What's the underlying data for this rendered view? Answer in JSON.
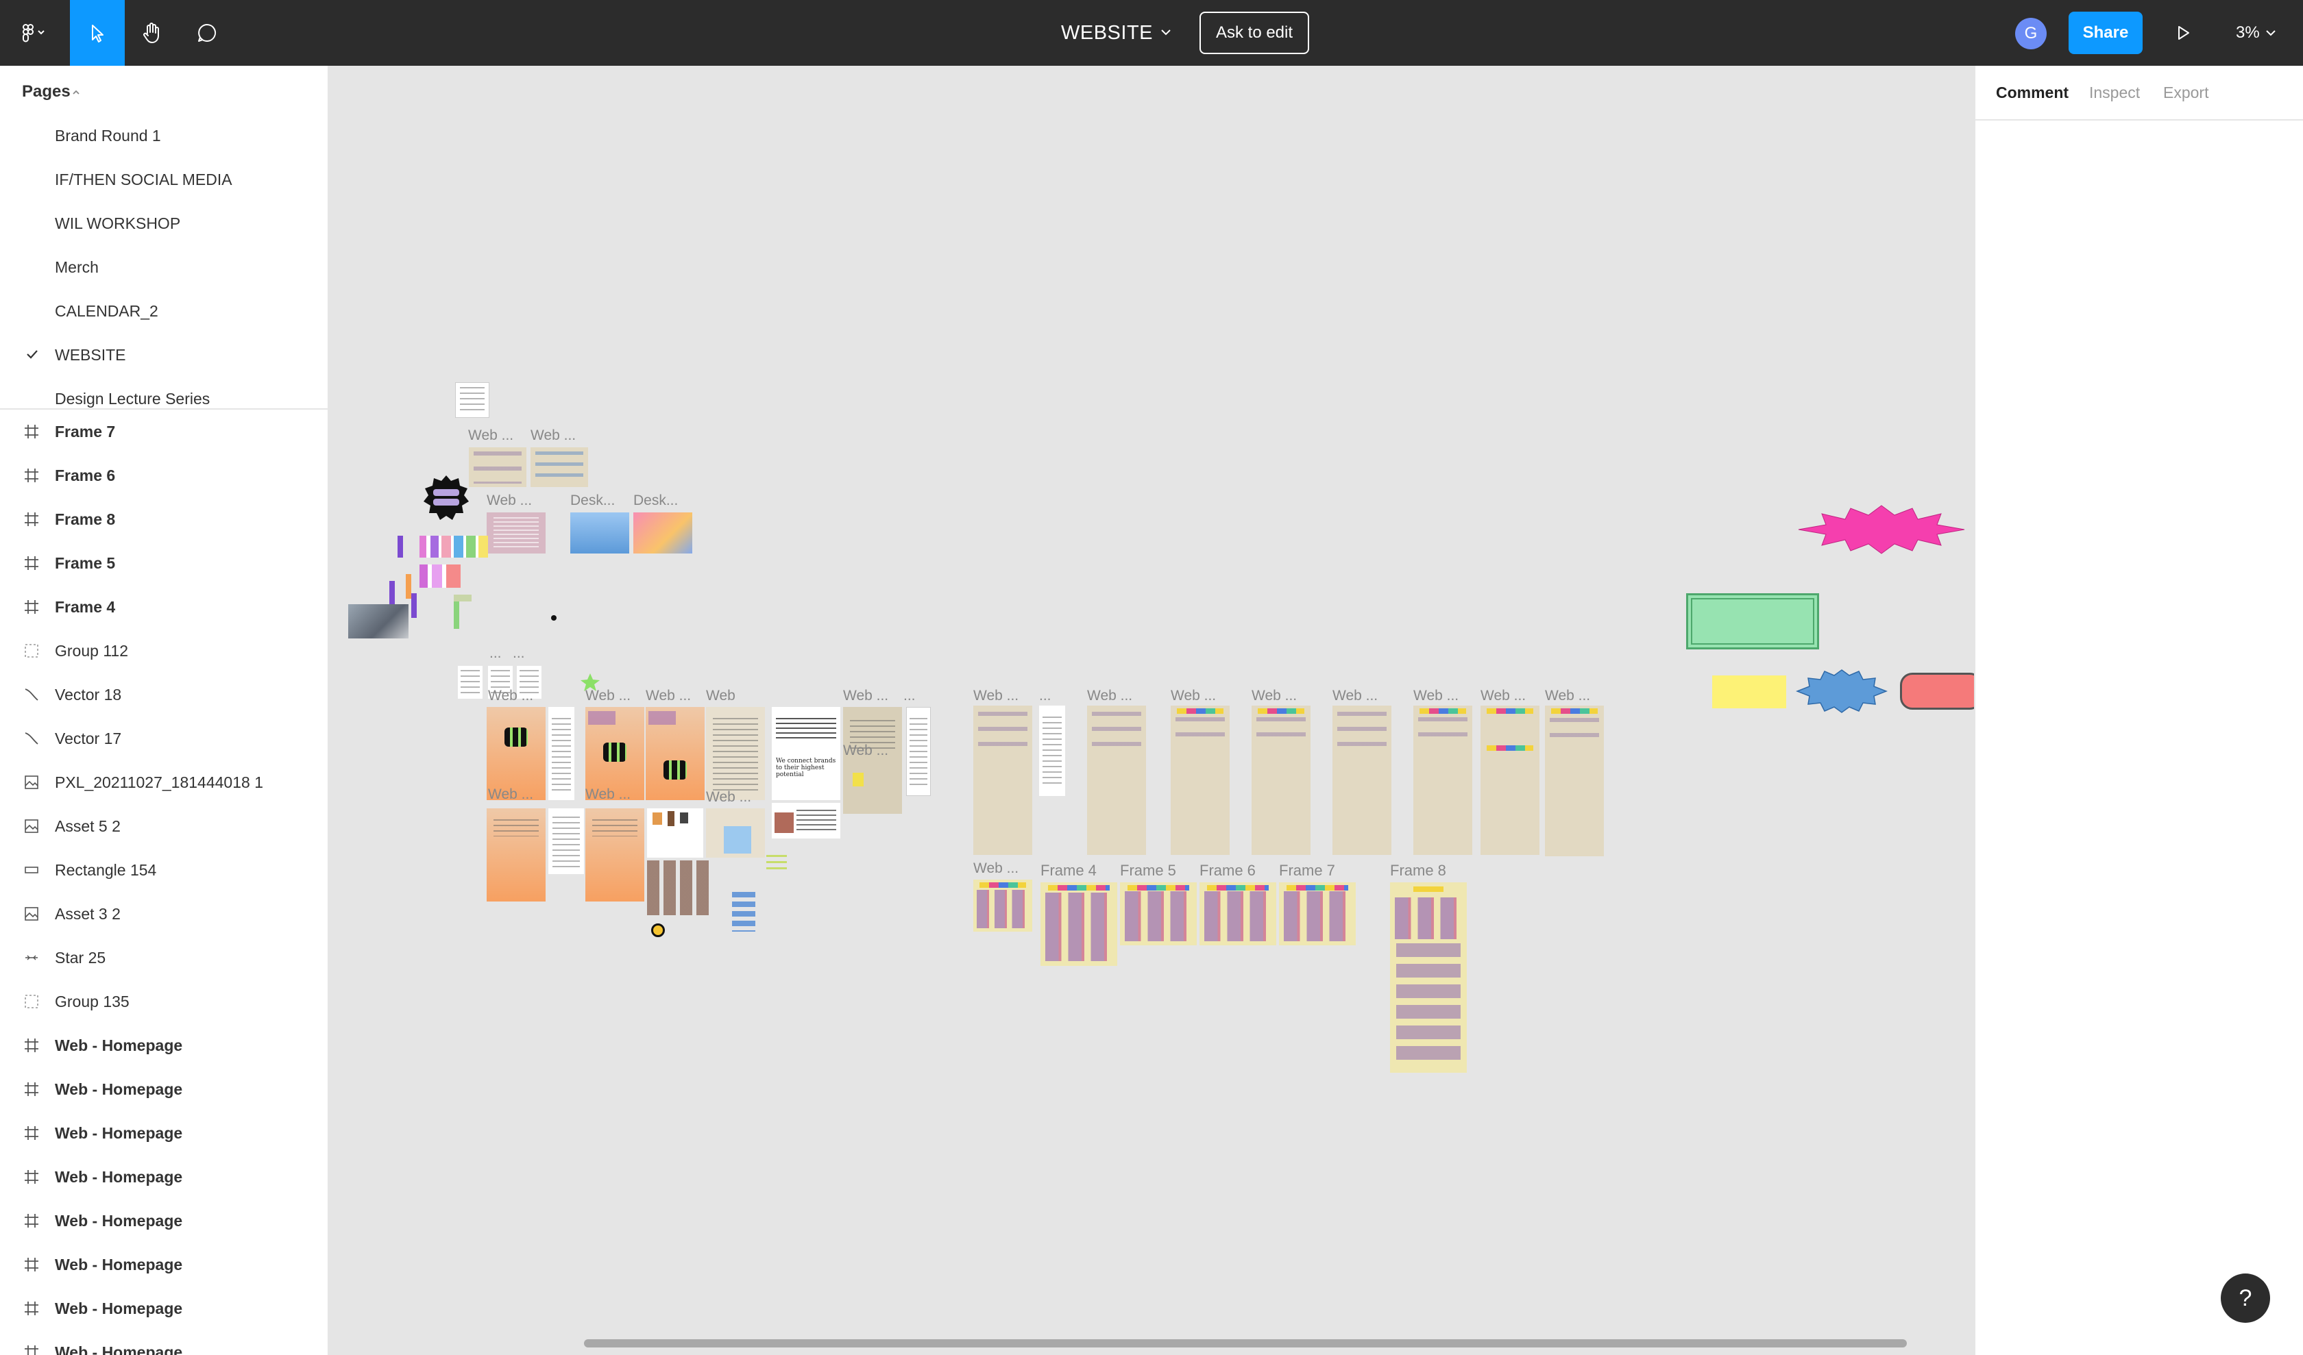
{
  "toolbar": {
    "file_name": "WEBSITE",
    "ask_to_edit": "Ask to edit",
    "avatar_initial": "G",
    "share": "Share",
    "zoom": "3%",
    "accent": "#0d99ff"
  },
  "pages": {
    "header": "Pages",
    "items": [
      {
        "label": "Brand Round 1"
      },
      {
        "label": "IF/THEN SOCIAL MEDIA"
      },
      {
        "label": "WIL WORKSHOP"
      },
      {
        "label": "Merch"
      },
      {
        "label": "CALENDAR_2"
      },
      {
        "label": "WEBSITE",
        "selected": true
      },
      {
        "label": "Design Lecture Series"
      }
    ]
  },
  "layers": [
    {
      "label": "Frame 7",
      "icon": "frame-icon"
    },
    {
      "label": "Frame 6",
      "icon": "frame-icon"
    },
    {
      "label": "Frame 8",
      "icon": "frame-icon"
    },
    {
      "label": "Frame 5",
      "icon": "frame-icon"
    },
    {
      "label": "Frame 4",
      "icon": "frame-icon"
    },
    {
      "label": "Group 112",
      "icon": "group-icon"
    },
    {
      "label": "Vector 18",
      "icon": "vector-icon"
    },
    {
      "label": "Vector 17",
      "icon": "vector-icon"
    },
    {
      "label": "PXL_20211027_181444018 1",
      "icon": "image-icon"
    },
    {
      "label": "Asset 5 2",
      "icon": "image-icon"
    },
    {
      "label": "Rectangle 154",
      "icon": "rectangle-icon"
    },
    {
      "label": "Asset 3 2",
      "icon": "image-icon"
    },
    {
      "label": "Star 25",
      "icon": "star-icon"
    },
    {
      "label": "Group 135",
      "icon": "group-icon"
    },
    {
      "label": "Web - Homepage",
      "icon": "frame-icon"
    },
    {
      "label": "Web - Homepage",
      "icon": "frame-icon"
    },
    {
      "label": "Web - Homepage",
      "icon": "frame-icon"
    },
    {
      "label": "Web - Homepage",
      "icon": "frame-icon"
    },
    {
      "label": "Web - Homepage",
      "icon": "frame-icon"
    },
    {
      "label": "Web - Homepage",
      "icon": "frame-icon"
    },
    {
      "label": "Web - Homepage",
      "icon": "frame-icon"
    },
    {
      "label": "Web - Homepage",
      "icon": "frame-icon"
    }
  ],
  "right_panel": {
    "tabs": [
      {
        "label": "Comment",
        "active": true
      },
      {
        "label": "Inspect"
      },
      {
        "label": "Export"
      }
    ]
  },
  "canvas": {
    "labels": {
      "web1": "Web ...",
      "web2": "Web ...",
      "web3": "Web ...",
      "desk1": "Desk...",
      "desk2": "Desk...",
      "web4": "Web ...",
      "web5": "Web ...",
      "web6": "Web ...",
      "web7": "Web",
      "web8": "Web ...",
      "web9": "Web ...",
      "web10": "Web ...",
      "web11": "Web ...",
      "web12": "Web ...",
      "web13": "Web ...",
      "web14": "Web ...",
      "web15": "Web ...",
      "web16": "Web ...",
      "web17": "Web ...",
      "web18": "Web ...",
      "web19": "Web ...",
      "web20": "Web ...",
      "web21": "Web ...",
      "web22": "Web ...",
      "dots1": "...",
      "dots2": "...",
      "dots3": "...",
      "frame4": "Frame 4",
      "frame5": "Frame 5",
      "frame6": "Frame 6",
      "frame7": "Frame 7",
      "frame8": "Frame 8",
      "tagline": "We connect brands to their highest potential"
    },
    "colors": {
      "pink_star": "#f53fae",
      "green_rect": "#97e3b1",
      "yellow_rect": "#fdf276",
      "blue_blob": "#5d9bd8",
      "coral_pill": "#f57a7a"
    }
  },
  "help": "?"
}
